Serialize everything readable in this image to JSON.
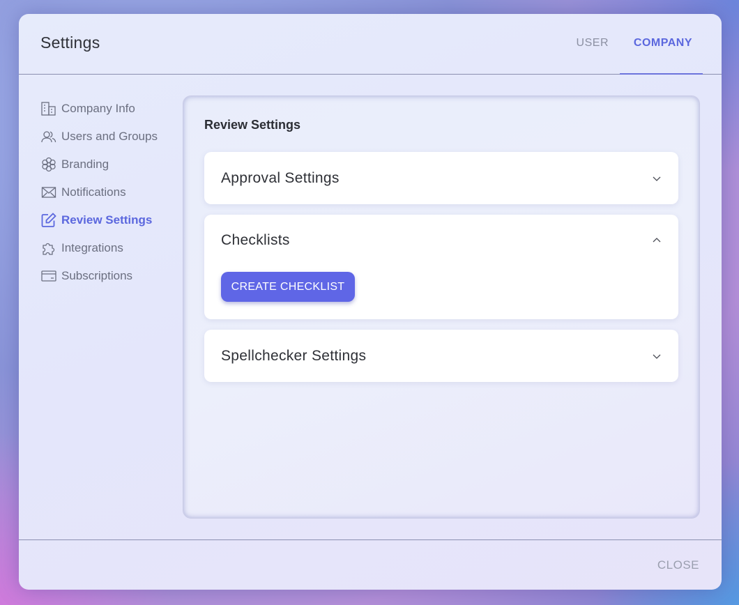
{
  "dialog": {
    "title": "Settings",
    "tabs": [
      {
        "label": "USER",
        "active": false
      },
      {
        "label": "COMPANY",
        "active": true
      }
    ],
    "close_label": "CLOSE"
  },
  "sidebar": {
    "items": [
      {
        "label": "Company Info",
        "icon": "building-icon",
        "active": false
      },
      {
        "label": "Users and Groups",
        "icon": "users-icon",
        "active": false
      },
      {
        "label": "Branding",
        "icon": "flower-icon",
        "active": false
      },
      {
        "label": "Notifications",
        "icon": "envelope-icon",
        "active": false
      },
      {
        "label": "Review Settings",
        "icon": "edit-icon",
        "active": true
      },
      {
        "label": "Integrations",
        "icon": "puzzle-icon",
        "active": false
      },
      {
        "label": "Subscriptions",
        "icon": "card-icon",
        "active": false
      }
    ]
  },
  "main": {
    "title": "Review Settings",
    "sections": [
      {
        "title": "Approval Settings",
        "expanded": false
      },
      {
        "title": "Checklists",
        "expanded": true,
        "button_label": "CREATE CHECKLIST"
      },
      {
        "title": "Spellchecker Settings",
        "expanded": false
      }
    ]
  },
  "colors": {
    "accent": "#5b67de",
    "button": "#5f66e6",
    "text": "#2e3036",
    "muted": "#6b6f80"
  }
}
